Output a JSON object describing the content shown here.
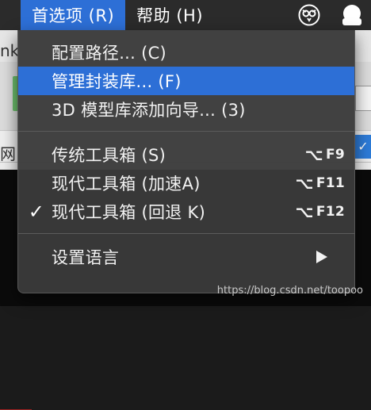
{
  "background": {
    "fragment_top": "nk",
    "fragment_row": "网"
  },
  "menubar": {
    "menus": [
      {
        "label": "首选项 (R)",
        "active": true
      },
      {
        "label": "帮助 (H)",
        "active": false
      }
    ],
    "status_icons": [
      "owl-icon",
      "user-avatar-icon"
    ]
  },
  "dropdown": {
    "groups": [
      [
        {
          "label": "配置路径... (C)",
          "highlighted": false
        },
        {
          "label": "管理封装库... (F)",
          "highlighted": true
        },
        {
          "label": "3D 模型库添加向导... (3)",
          "highlighted": false
        }
      ],
      [
        {
          "label": "传统工具箱 (S)",
          "checked": false,
          "shortcut_symbol": "⌥",
          "shortcut_key": "F9"
        },
        {
          "label": "现代工具箱 (加速A)",
          "checked": false,
          "shortcut_symbol": "⌥",
          "shortcut_key": "F11"
        },
        {
          "label": "现代工具箱 (回退 K)",
          "checked": true,
          "check_mark": "✓",
          "shortcut_symbol": "⌥",
          "shortcut_key": "F12"
        }
      ],
      [
        {
          "label": "设置语言",
          "has_submenu": true
        }
      ]
    ]
  },
  "watermark": "https://blog.csdn.net/toopoo",
  "colors": {
    "accent": "#2d6fd6",
    "menu_bg": "#3a3a3a",
    "menubar_bg": "#2b2b2b"
  }
}
